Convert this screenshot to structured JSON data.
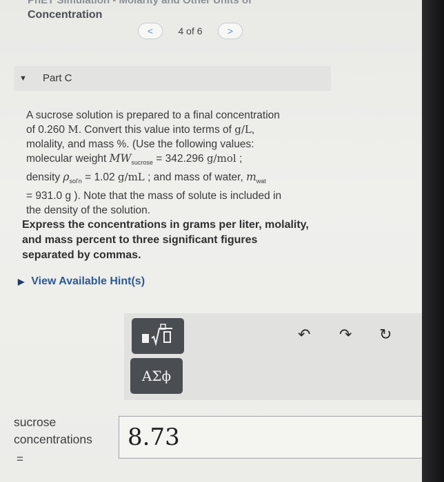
{
  "header": {
    "title_line1": "PhET Simulation - Molarity and Other Units of",
    "title_line2": "Concentration"
  },
  "pager": {
    "prev_icon": "<",
    "next_icon": ">",
    "text": "4 of 6"
  },
  "part": {
    "caret": "▼",
    "label": "Part C"
  },
  "problem": {
    "t1": "A sucrose solution is prepared to a final concentration",
    "t2a": "of 0.260 ",
    "t2m": "M",
    "t2b": ". Convert this value into terms of ",
    "t2c": "g/L",
    "t2d": ",",
    "t3": "molality, and mass %. (Use the following values:",
    "t4a": "molecular weight ",
    "t4m": "MW",
    "t4s": "sucrose",
    "t4b": " = 342.296 ",
    "t4c": "g/mol",
    "t4d": " ;",
    "t5a": "density ",
    "t5m": "ρ",
    "t5s": "sol'n",
    "t5b": " = 1.02 ",
    "t5c": "g/mL",
    "t5d": " ; and mass of water, ",
    "t5e": "m",
    "t5f": "wat",
    "t6": "= 931.0 g ). Note that the mass of solute is included in",
    "t7": "the density of the solution."
  },
  "instructions": {
    "l1": "Express the concentrations in grams per liter, molality,",
    "l2": "and mass percent to three significant figures",
    "l3": "separated by commas."
  },
  "hints": {
    "icon": "▶",
    "label": "View Available Hint(s)"
  },
  "toolbar": {
    "templates_icon": "■√□",
    "symbols_label": "ΑΣϕ",
    "undo_icon": "↶",
    "redo_icon": "↷",
    "reset_icon": "↻"
  },
  "answer": {
    "label1": "sucrose",
    "label2": "concentrations",
    "equals": "=",
    "value": "8.73"
  }
}
